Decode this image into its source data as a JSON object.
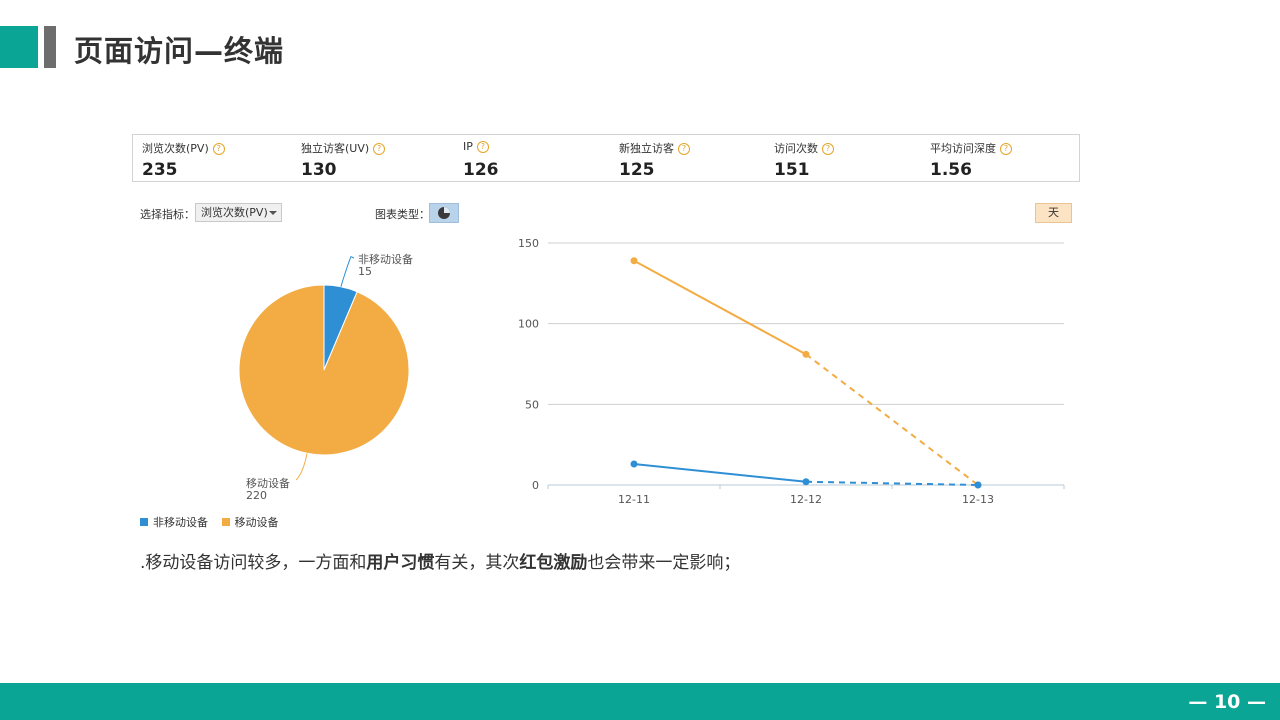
{
  "page": {
    "title": "页面访问—终端",
    "page_number": "— 10 —"
  },
  "metrics": [
    {
      "label": "浏览次数(PV)",
      "value": "235"
    },
    {
      "label": "独立访客(UV)",
      "value": "130"
    },
    {
      "label": "IP",
      "value": "126"
    },
    {
      "label": "新独立访客",
      "value": "125"
    },
    {
      "label": "访问次数",
      "value": "151"
    },
    {
      "label": "平均访问深度",
      "value": "1.56"
    }
  ],
  "controls": {
    "select_metric_label": "选择指标：",
    "select_metric_value": "浏览次数(PV)",
    "chart_type_label": "图表类型：",
    "granularity_button": "天"
  },
  "colors": {
    "accent": "#0aa595",
    "non_mobile": "#2f8fd5",
    "mobile": "#f3ab43"
  },
  "chart_data": [
    {
      "type": "pie",
      "slices": [
        {
          "name": "非移动设备",
          "value": 15,
          "color": "#2f8fd5"
        },
        {
          "name": "移动设备",
          "value": 220,
          "color": "#f3ab43"
        }
      ]
    },
    {
      "type": "line",
      "x": [
        "12-11",
        "12-12",
        "12-13"
      ],
      "ylim": [
        0,
        150
      ],
      "yticks": [
        0,
        50,
        100,
        150
      ],
      "series": [
        {
          "name": "移动设备",
          "values": [
            139,
            81,
            0
          ],
          "color": "#f3ab43"
        },
        {
          "name": "非移动设备",
          "values": [
            13,
            2,
            0
          ],
          "color": "#2f8fd5"
        }
      ]
    }
  ],
  "legend": [
    {
      "name": "非移动设备",
      "color": "#2f8fd5"
    },
    {
      "name": "移动设备",
      "color": "#f3ab43"
    }
  ],
  "caption": {
    "part1": ".移动设备访问较多，一方面和",
    "bold1": "用户习惯",
    "part2": "有关，其次",
    "bold2": "红包激励",
    "part3": "也会带来一定影响；"
  }
}
